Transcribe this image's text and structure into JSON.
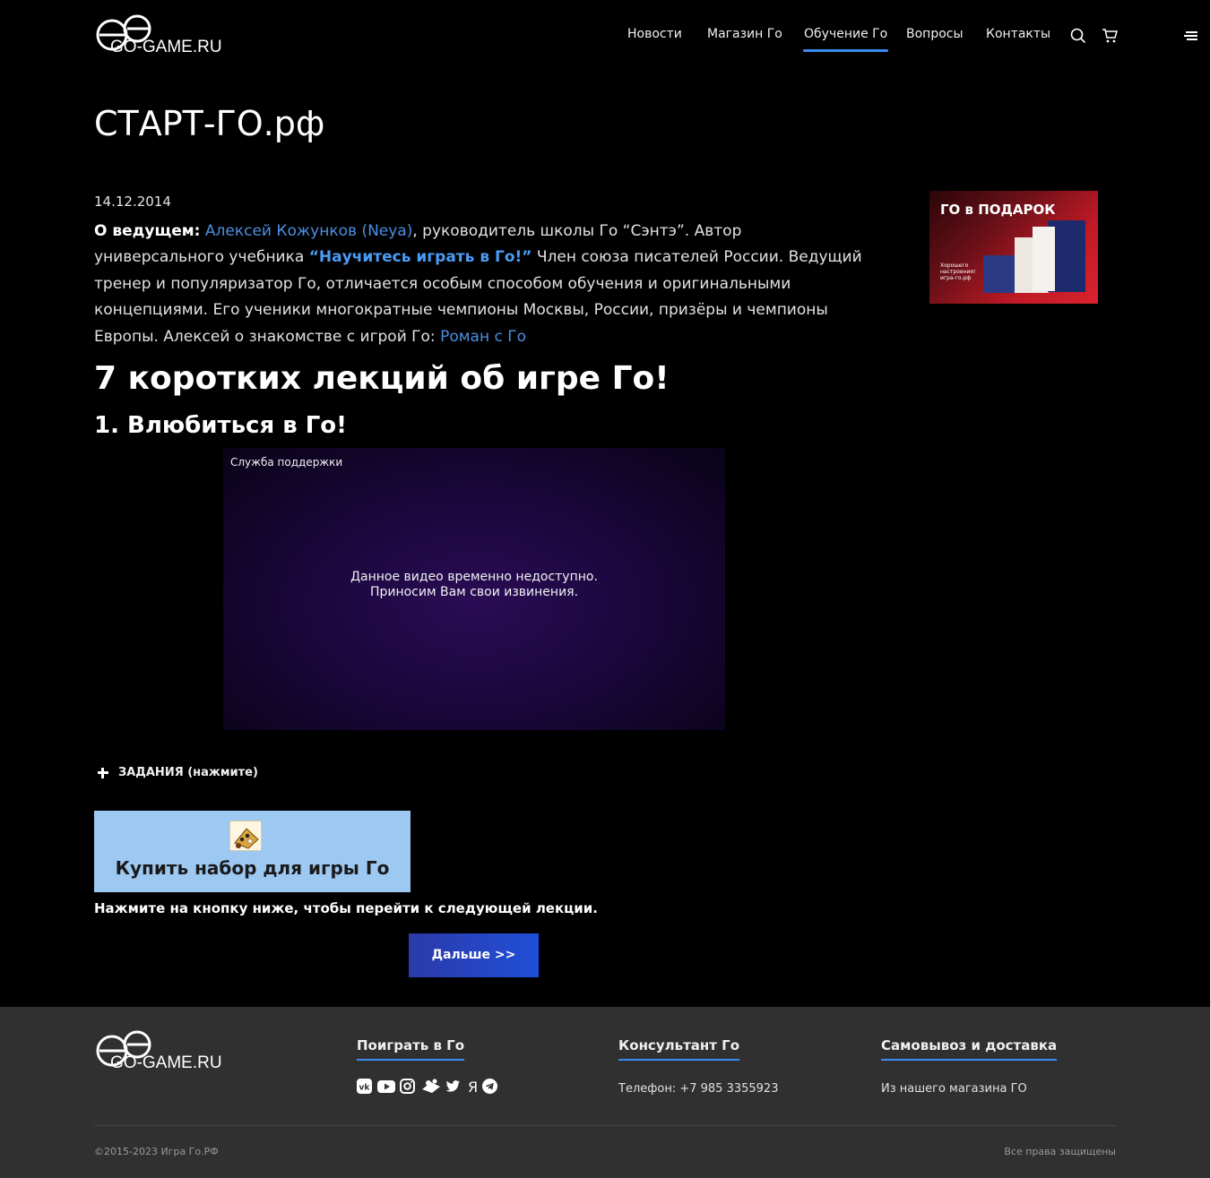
{
  "header": {
    "logo_text": "GO-GAME.RU",
    "nav": [
      {
        "label": "Новости"
      },
      {
        "label": "Магазин Го"
      },
      {
        "label": "Обучение Го",
        "active": true
      },
      {
        "label": "Вопросы"
      },
      {
        "label": "Контакты"
      }
    ],
    "icons": [
      "search-icon",
      "cart-icon",
      "menu-icon"
    ]
  },
  "page": {
    "title": "СТАРТ-ГО.рф",
    "date": "14.12.2014",
    "intro": {
      "lead": "О ведущем:",
      "host_link": "Алексей Кожунков (Neya)",
      "text1": ", руководитель школы Го “Сэнтэ”. Автор универсального учебника ",
      "book_link": "“Научитесь играть в Го!”",
      "text2": " Член союза писателей России. Ведущий тренер и популяризатор Го, отличается особым способом обучения и оригинальными концепциями. Его ученики многократные чемпионы Москвы, России, призёры и чемпионы Европы. Алексей о знакомстве с игрой Го: ",
      "story_link": "Роман с Го"
    },
    "heading": "7 коротких лекций об игре Го!",
    "lecture_title": "1. Влюбиться в Го!",
    "video": {
      "channel": "Служба поддержки",
      "message_line1": "Данное видео временно недоступно.",
      "message_line2": "Приносим Вам свои извинения."
    },
    "tasks_label": "ЗАДАНИЯ (нажмите)",
    "buy_label": "Купить набор для игры Го",
    "next_note": "Нажмите на кнопку ниже, чтобы перейти к следующей лекции.",
    "next_button": "Дальше >>"
  },
  "promo": {
    "title": "ГО в ПОДАРОК",
    "subtitle": "Хорошего настроения! игра-го.рф"
  },
  "footer": {
    "logo_text": "GO-GAME.RU",
    "col1_title": "Поиграть в Го",
    "col2_title": "Консультант Го",
    "col2_text": "Телефон: +7 985 3355923",
    "col3_title": "Самовывоз и доставка",
    "col3_text": "Из нашего магазина ГО",
    "social_icons": [
      "vk-icon",
      "youtube-icon",
      "instagram-icon",
      "go-board-icon",
      "twitter-icon",
      "yandex-icon",
      "telegram-icon"
    ],
    "copyright": "©2015-2023 Игра Го.РФ",
    "rights": "Все права защищены"
  },
  "colors": {
    "accent": "#3b8cf0",
    "link": "#4a90e2",
    "background": "#000000",
    "footer_bg": "#303030",
    "buy_bg": "#9cc8f2"
  }
}
